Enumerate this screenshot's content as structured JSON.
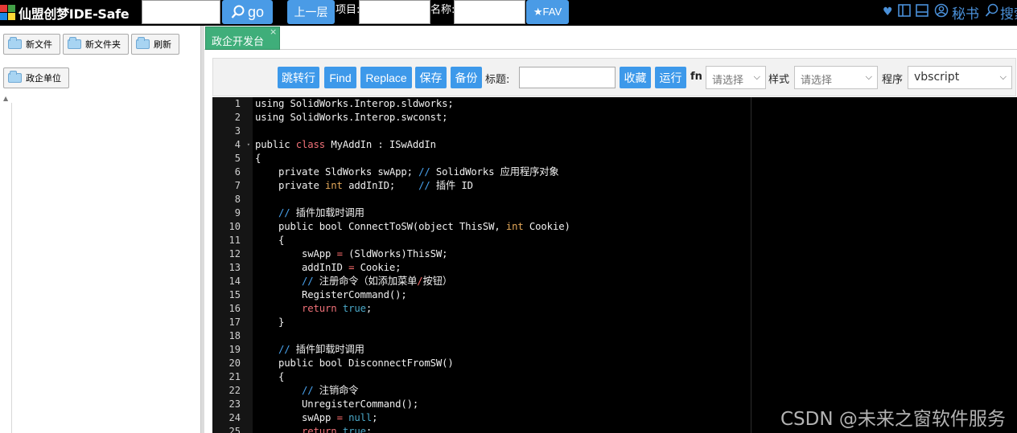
{
  "header": {
    "app_title": "仙盟创梦IDE-Safe",
    "search_value": "",
    "go_label": "go",
    "go_icon": "search-icon",
    "up_label": "上一层",
    "project_label": "项目:",
    "project_value": "",
    "name_label": "名称:",
    "name_value": "",
    "fav_label": "★FAV",
    "right": {
      "secretary_label": "秘书",
      "search_label": "搜索"
    }
  },
  "sidebar": {
    "new_file": "新文件",
    "new_folder": "新文件夹",
    "refresh": "刷新",
    "gov_unit": "政企单位"
  },
  "tabs": [
    {
      "label": "政企开发台",
      "close": "×",
      "active": true
    }
  ],
  "toolbar": {
    "goto_line": "跳转行",
    "find": "Find",
    "replace": "Replace",
    "save": "保存",
    "backup": "备份",
    "title_label": "标题:",
    "title_value": "",
    "favorite": "收藏",
    "run": "运行",
    "fn_label": "fn",
    "fn_select": "请选择",
    "style_label": "样式",
    "style_select": "请选择",
    "program_label": "程序",
    "program_select": "vbscript"
  },
  "editor": {
    "line_numbers": [
      "1",
      "2",
      "3",
      "4",
      "5",
      "6",
      "7",
      "8",
      "9",
      "10",
      "11",
      "12",
      "13",
      "14",
      "15",
      "16",
      "17",
      "18",
      "19",
      "20",
      "21",
      "22",
      "23",
      "24",
      "25"
    ],
    "lines": [
      [
        [
          "t",
          "using SolidWorks.Interop.sldworks;"
        ]
      ],
      [
        [
          "t",
          "using SolidWorks.Interop.swconst;"
        ]
      ],
      [],
      [
        [
          "t",
          "public "
        ],
        [
          "kw",
          "class"
        ],
        [
          "t",
          " MyAddIn : ISwAddIn"
        ]
      ],
      [
        [
          "t",
          "{"
        ]
      ],
      [
        [
          "t",
          "    private SldWorks swApp; "
        ],
        [
          "cm",
          "// "
        ],
        [
          "t",
          "SolidWorks 应用程序对象"
        ]
      ],
      [
        [
          "t",
          "    private "
        ],
        [
          "ty",
          "int"
        ],
        [
          "t",
          " addInID;    "
        ],
        [
          "cm",
          "//"
        ],
        [
          "t",
          " 插件 ID"
        ]
      ],
      [],
      [
        [
          "cm",
          "    // "
        ],
        [
          "t",
          "插件加载时调用"
        ]
      ],
      [
        [
          "t",
          "    public bool ConnectToSW(object ThisSW, "
        ],
        [
          "ty",
          "int"
        ],
        [
          "t",
          " Cookie)"
        ]
      ],
      [
        [
          "t",
          "    {"
        ]
      ],
      [
        [
          "t",
          "        swApp "
        ],
        [
          "op",
          "="
        ],
        [
          "t",
          " (SldWorks)ThisSW;"
        ]
      ],
      [
        [
          "t",
          "        addInID "
        ],
        [
          "op",
          "="
        ],
        [
          "t",
          " Cookie;"
        ]
      ],
      [
        [
          "cm",
          "        // "
        ],
        [
          "t",
          "注册命令（如添加菜单"
        ],
        [
          "op",
          "/"
        ],
        [
          "t",
          "按钮）"
        ]
      ],
      [
        [
          "t",
          "        RegisterCommand();"
        ]
      ],
      [
        [
          "kw",
          "        return"
        ],
        [
          "t",
          " "
        ],
        [
          "lit",
          "true"
        ],
        [
          "t",
          ";"
        ]
      ],
      [
        [
          "t",
          "    }"
        ]
      ],
      [],
      [
        [
          "cm",
          "    // "
        ],
        [
          "t",
          "插件卸载时调用"
        ]
      ],
      [
        [
          "t",
          "    public bool DisconnectFromSW()"
        ]
      ],
      [
        [
          "t",
          "    {"
        ]
      ],
      [
        [
          "cm",
          "        // "
        ],
        [
          "t",
          "注销命令"
        ]
      ],
      [
        [
          "t",
          "        UnregisterCommand();"
        ]
      ],
      [
        [
          "t",
          "        swApp "
        ],
        [
          "op",
          "="
        ],
        [
          "t",
          " "
        ],
        [
          "lit",
          "null"
        ],
        [
          "t",
          ";"
        ]
      ],
      [
        [
          "kw",
          "        return"
        ],
        [
          "t",
          " "
        ],
        [
          "lit",
          "true"
        ],
        [
          "t",
          ";"
        ]
      ]
    ],
    "fold_markers": {
      "4": "▾"
    }
  },
  "watermark": "CSDN @未来之窗软件服务",
  "colors": {
    "topbar_bg": "#000000",
    "button_blue": "#3d99ea",
    "tab_green": "#3fae7a",
    "editor_bg": "#000000",
    "keyword": "#f07178",
    "type": "#e4a85a",
    "comment": "#4aa4f0",
    "literal": "#4aa8c8"
  }
}
